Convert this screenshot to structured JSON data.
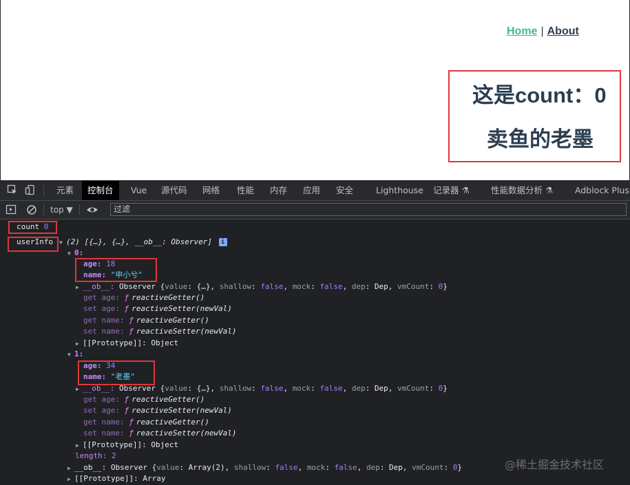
{
  "app": {
    "nav": {
      "home": "Home",
      "separator": "|",
      "about": "About"
    },
    "count_line": "这是count：0",
    "name_line": "卖鱼的老墨"
  },
  "devtools": {
    "tabs": [
      "元素",
      "控制台",
      "Vue",
      "源代码",
      "网络",
      "性能",
      "内存",
      "应用",
      "安全",
      "Lighthouse",
      "记录器 ⚗",
      "性能数据分析 ⚗",
      "Adblock Plus"
    ],
    "active_tab": "控制台",
    "context": "top ▼",
    "filter_placeholder": "过滤"
  },
  "console": {
    "count_label": "count",
    "count_value": "0",
    "userinfo_label": "userInfo",
    "array_summary_prefix": "(2) [{…}, {…}, __ob__: ",
    "array_summary_type": "Observer",
    "array_summary_suffix": "]",
    "info_badge": "i",
    "items": [
      {
        "index": "0:",
        "age_key": "age:",
        "age": "18",
        "name_key": "name:",
        "name": "\"申小兮\"",
        "ob_key": "__ob__:",
        "ob_value": "Observer {value: {…}, shallow: false, mock: false, dep: Dep, vmCount: 0}",
        "get_age": "get age:",
        "get_age_fn": "reactiveGetter()",
        "set_age": "set age:",
        "set_age_fn": "reactiveSetter(newVal)",
        "get_name": "get name:",
        "get_name_fn": "reactiveGetter()",
        "set_name": "set name:",
        "set_name_fn": "reactiveSetter(newVal)",
        "proto": "[[Prototype]]: Object"
      },
      {
        "index": "1:",
        "age_key": "age:",
        "age": "34",
        "name_key": "name:",
        "name": "\"老墨\"",
        "ob_key": "__ob__:",
        "ob_value": "Observer {value: {…}, shallow: false, mock: false, dep: Dep, vmCount: 0}",
        "get_age": "get age:",
        "get_age_fn": "reactiveGetter()",
        "set_age": "set age:",
        "set_age_fn": "reactiveSetter(newVal)",
        "get_name": "get name:",
        "get_name_fn": "reactiveGetter()",
        "set_name": "set name:",
        "set_name_fn": "reactiveSetter(newVal)",
        "proto": "[[Prototype]]: Object"
      }
    ],
    "length_key": "length:",
    "length_value": "2",
    "array_ob": "__ob__: Observer {value: Array(2), shallow: false, mock: false, dep: Dep, vmCount: 0}",
    "array_proto": "[[Prototype]]: Array"
  },
  "watermark": "@稀土掘金技术社区",
  "colors": {
    "highlight_box": "#e0373a",
    "vue_green": "#42b983",
    "devtools_bg": "#202124"
  }
}
